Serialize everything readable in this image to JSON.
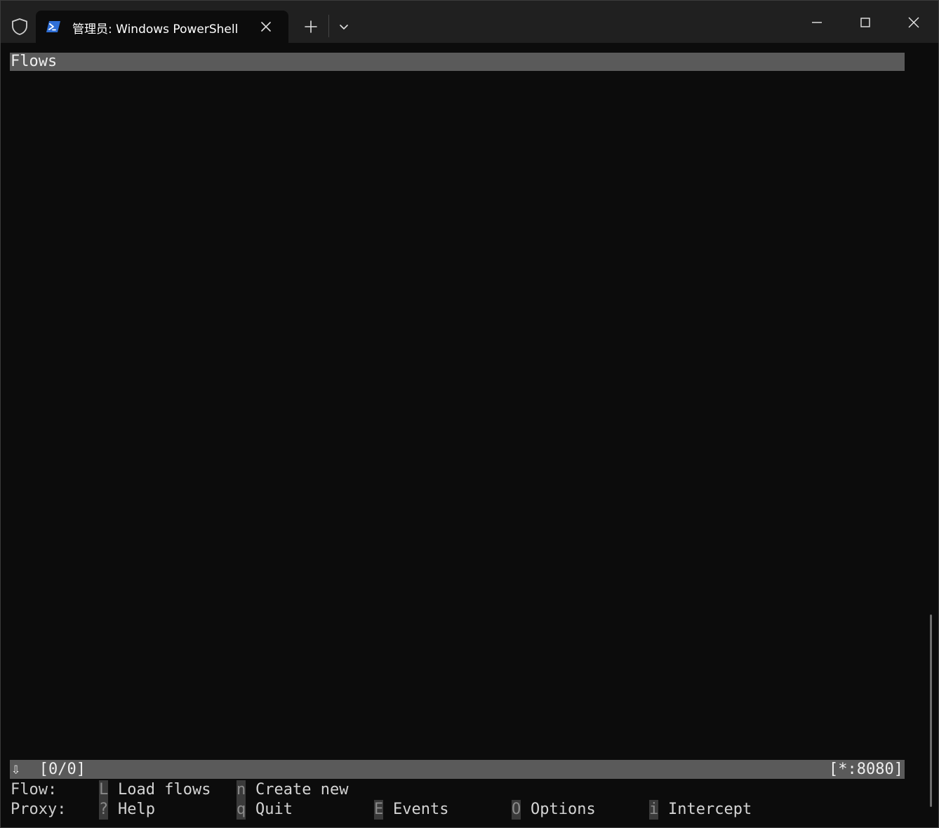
{
  "titlebar": {
    "tab_title": "管理员: Windows PowerShell"
  },
  "terminal": {
    "header_title": "Flows",
    "status_left": "⇩  [0/0]",
    "status_right": "[*:8080]",
    "flow_row": {
      "label": "Flow:",
      "items": [
        {
          "key": "L",
          "label": "Load flows"
        },
        {
          "key": "n",
          "label": "Create new"
        }
      ]
    },
    "proxy_row": {
      "label": "Proxy:",
      "items": [
        {
          "key": "?",
          "label": "Help"
        },
        {
          "key": "q",
          "label": "Quit"
        },
        {
          "key": "E",
          "label": "Events"
        },
        {
          "key": "O",
          "label": "Options"
        },
        {
          "key": "i",
          "label": "Intercept"
        }
      ]
    }
  },
  "colors": {
    "terminal_bg": "#0c0c0c",
    "titlebar_bg": "#202020",
    "bar_bg": "#5a5a5a",
    "key_bg": "#3a3a3a"
  }
}
